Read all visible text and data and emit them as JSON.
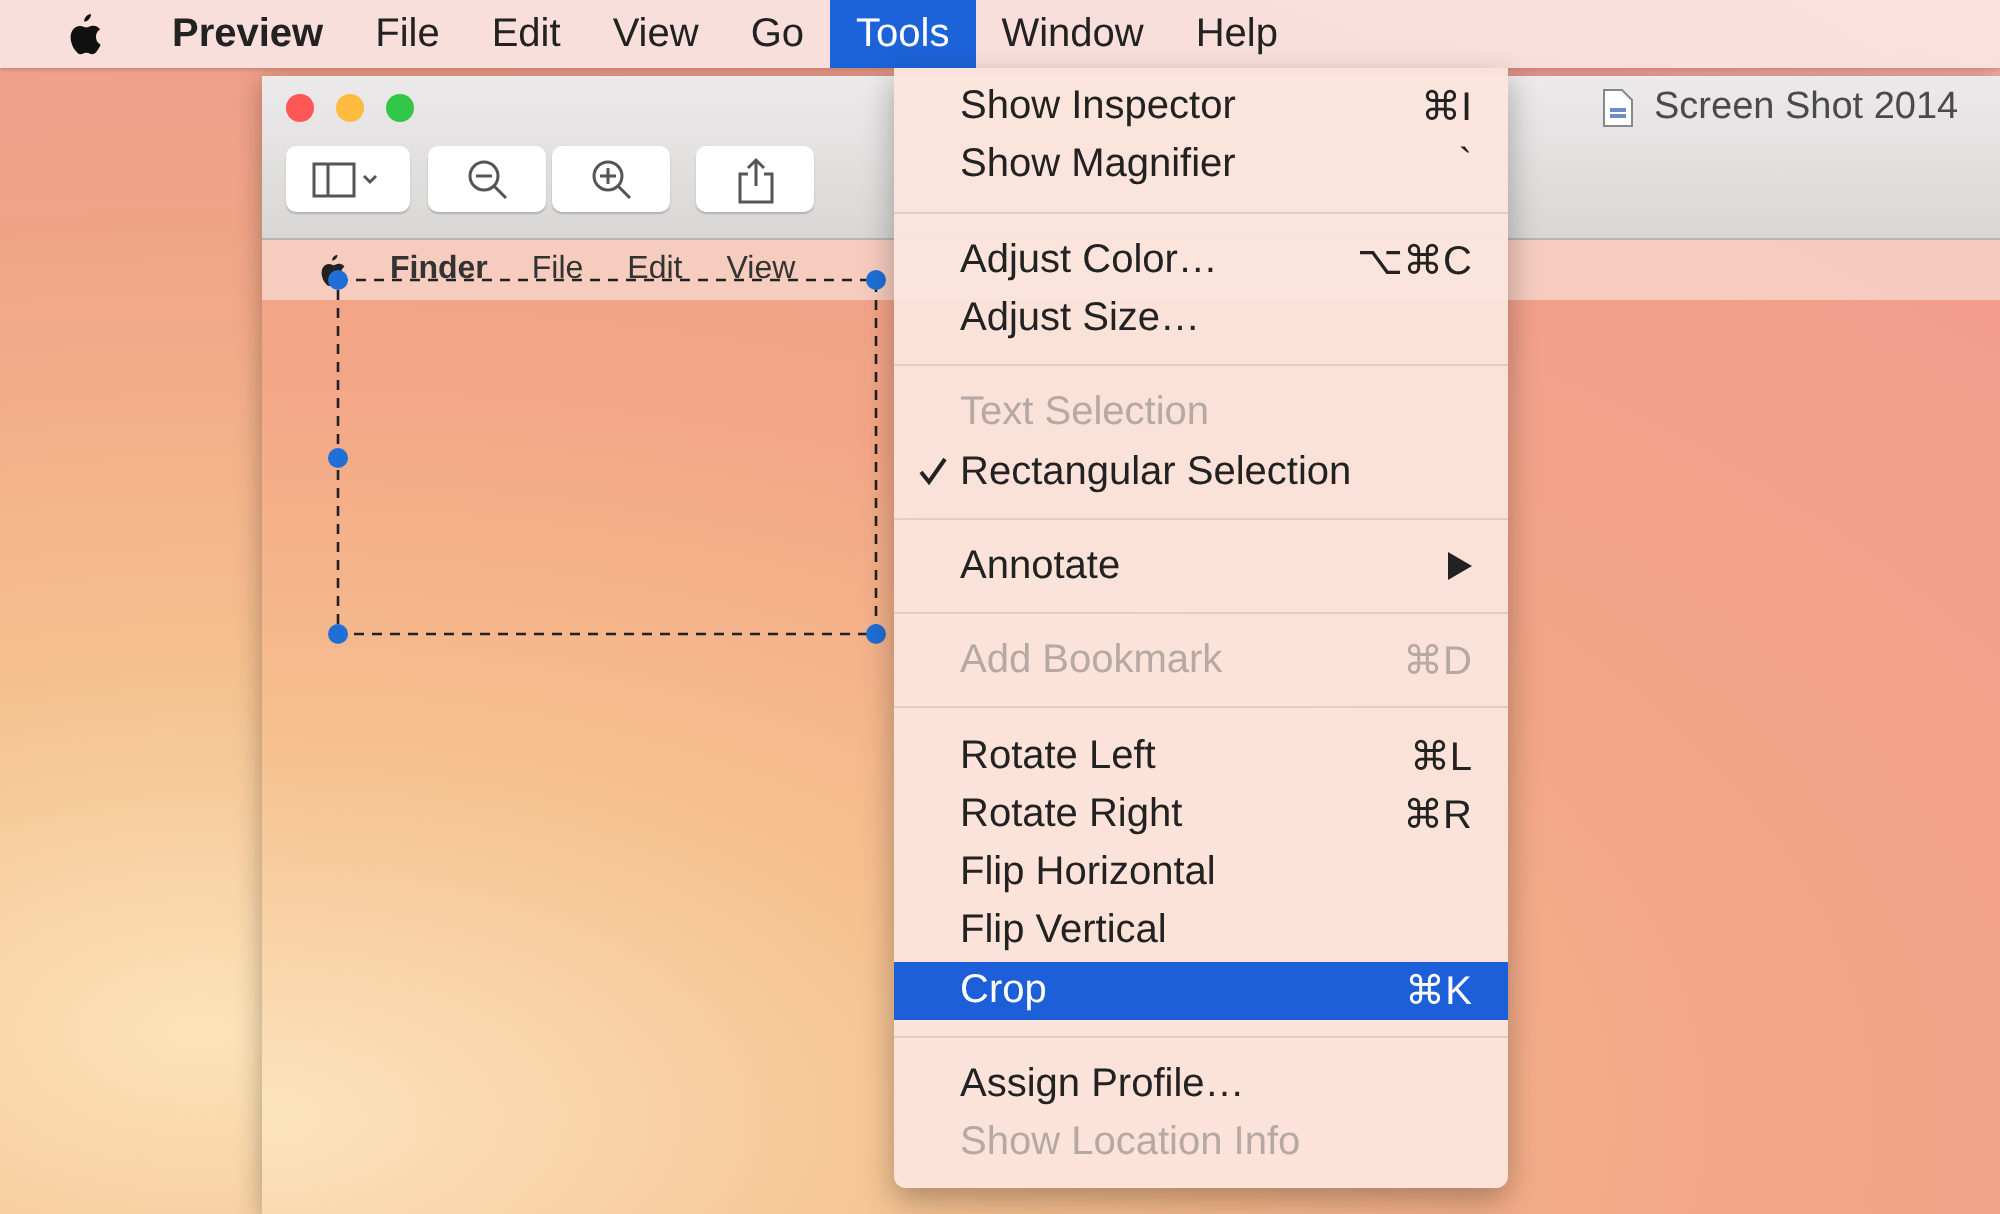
{
  "menu_bar": {
    "items": [
      {
        "label": "Preview",
        "kind": "app",
        "selected": false
      },
      {
        "label": "File",
        "kind": "menu",
        "selected": false
      },
      {
        "label": "Edit",
        "kind": "menu",
        "selected": false
      },
      {
        "label": "View",
        "kind": "menu",
        "selected": false
      },
      {
        "label": "Go",
        "kind": "menu",
        "selected": false
      },
      {
        "label": "Tools",
        "kind": "menu",
        "selected": true
      },
      {
        "label": "Window",
        "kind": "menu",
        "selected": false
      },
      {
        "label": "Help",
        "kind": "menu",
        "selected": false
      }
    ]
  },
  "window": {
    "title": "Screen Shot 2014"
  },
  "document": {
    "menu_bar_items": [
      {
        "label": "Finder",
        "kind": "app"
      },
      {
        "label": "File",
        "kind": "menu"
      },
      {
        "label": "Edit",
        "kind": "menu"
      },
      {
        "label": "View",
        "kind": "menu"
      }
    ]
  },
  "tools_menu": {
    "groups": [
      [
        {
          "label": "Show Inspector",
          "shortcut": "⌘I",
          "kind": "item",
          "disabled": false,
          "checked": false,
          "selected": false
        },
        {
          "label": "Show Magnifier",
          "shortcut": "`",
          "kind": "item",
          "disabled": false,
          "checked": false,
          "selected": false
        }
      ],
      [
        {
          "label": "Adjust Color…",
          "shortcut": "⌥⌘C",
          "kind": "item",
          "disabled": false,
          "checked": false,
          "selected": false
        },
        {
          "label": "Adjust Size…",
          "kind": "item",
          "disabled": false,
          "checked": false,
          "selected": false
        }
      ],
      [
        {
          "label": "Text Selection",
          "kind": "item",
          "disabled": true,
          "checked": false,
          "selected": false
        },
        {
          "label": "Rectangular Selection",
          "kind": "item",
          "disabled": false,
          "checked": true,
          "selected": false
        }
      ],
      [
        {
          "label": "Annotate",
          "kind": "submenu",
          "disabled": false,
          "checked": false,
          "selected": false
        }
      ],
      [
        {
          "label": "Add Bookmark",
          "shortcut": "⌘D",
          "kind": "item",
          "disabled": true,
          "checked": false,
          "selected": false
        }
      ],
      [
        {
          "label": "Rotate Left",
          "shortcut": "⌘L",
          "kind": "item",
          "disabled": false,
          "checked": false,
          "selected": false
        },
        {
          "label": "Rotate Right",
          "shortcut": "⌘R",
          "kind": "item",
          "disabled": false,
          "checked": false,
          "selected": false
        },
        {
          "label": "Flip Horizontal",
          "kind": "item",
          "disabled": false,
          "checked": false,
          "selected": false
        },
        {
          "label": "Flip Vertical",
          "kind": "item",
          "disabled": false,
          "checked": false,
          "selected": false
        },
        {
          "label": "Crop",
          "shortcut": "⌘K",
          "kind": "item",
          "disabled": false,
          "checked": false,
          "selected": true
        }
      ],
      [
        {
          "label": "Assign Profile…",
          "kind": "item",
          "disabled": false,
          "checked": false,
          "selected": false
        },
        {
          "label": "Show Location Info",
          "kind": "item",
          "disabled": true,
          "checked": false,
          "selected": false
        }
      ]
    ]
  }
}
